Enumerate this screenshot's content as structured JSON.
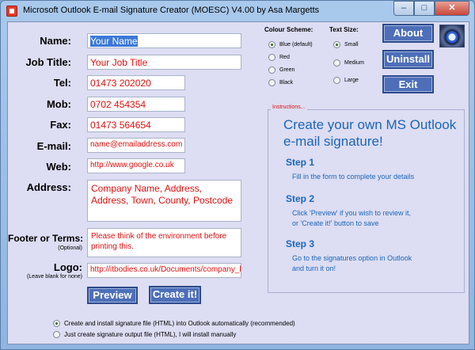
{
  "window": {
    "title": "Microsoft Outlook E-mail Signature Creator (MOESC) V4.00 by Asa Margetts",
    "minimize": "–",
    "maximize": "□",
    "close": "✕"
  },
  "form": {
    "name_label": "Name:",
    "name_value": "Your Name",
    "job_label": "Job Title:",
    "job_value": "Your Job Title",
    "tel_label": "Tel:",
    "tel_value": "01473 202020",
    "mob_label": "Mob:",
    "mob_value": "0702 454354",
    "fax_label": "Fax:",
    "fax_value": "01473 564654",
    "email_label": "E-mail:",
    "email_value": "name@emailaddress.com",
    "web_label": "Web:",
    "web_value": "http://www.google.co.uk",
    "address_label": "Address:",
    "address_value": "Company Name, Address, Address, Town, County, Postcode",
    "footer_label": "Footer or Terms:",
    "footer_sub": "(Optional)",
    "footer_value": "Please think of the environment before printing this.",
    "logo_label": "Logo:",
    "logo_sub": "(Leave blank for none)",
    "logo_value": "http://itbodies.co.uk/Documents/company_l"
  },
  "colour_scheme": {
    "title": "Colour Scheme:",
    "options": [
      "Blue (default)",
      "Red",
      "Green",
      "Black"
    ],
    "selected": "Blue (default)"
  },
  "text_size": {
    "title": "Text Size:",
    "options": [
      "Small",
      "Medium",
      "Large"
    ],
    "selected": "Small"
  },
  "buttons": {
    "about": "About",
    "uninstall": "Uninstall",
    "exit": "Exit",
    "preview": "Preview",
    "create": "Create it!"
  },
  "instructions": {
    "caption": "Instructions...",
    "heading": "Create your own MS Outlook e-mail signature!",
    "steps": [
      {
        "title": "Step 1",
        "lines": [
          "Fill in the form to complete your details"
        ]
      },
      {
        "title": "Step 2",
        "lines": [
          "Click 'Preview' if you wish to review it,",
          "or 'Create it!' button to save"
        ]
      },
      {
        "title": "Step 3",
        "lines": [
          "Go to the signatures option in Outlook",
          "and turn it on!"
        ]
      }
    ]
  },
  "install": {
    "option_auto": "Create and install signature file (HTML) into Outlook automatically (recommended)",
    "option_manual": "Just create signature output file (HTML), I will install manually",
    "selected": "auto"
  },
  "colors": {
    "field_text": "#e01010",
    "instructions_text": "#1a66b8",
    "button_bg": "#4e6fb8",
    "client_bg": "#ddddf3"
  },
  "icons": {
    "app": "outlook-signature-app-icon",
    "logo_image": "blue-eye-icon"
  }
}
